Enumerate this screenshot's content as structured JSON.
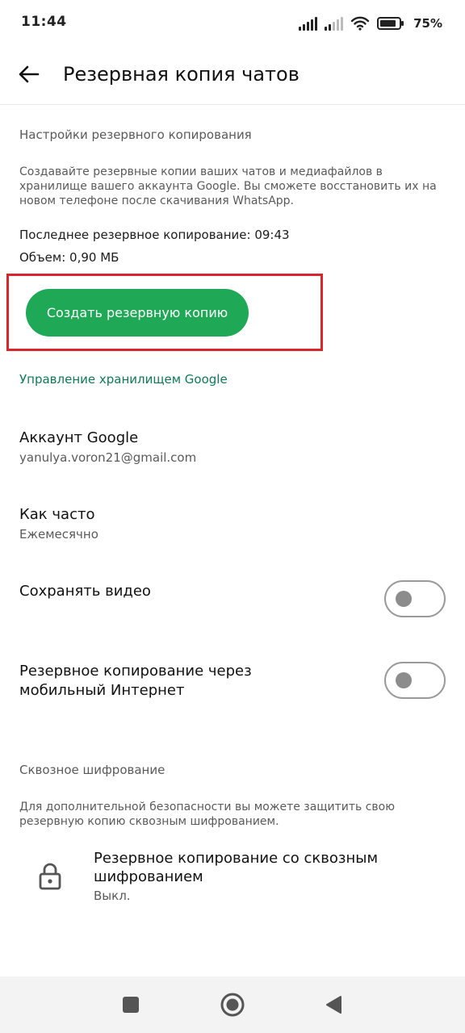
{
  "status_bar": {
    "time": "11:44",
    "battery": "75%"
  },
  "app_bar": {
    "title": "Резервная копия чатов"
  },
  "backup_settings": {
    "section_label": "Настройки резервного копирования",
    "description": "Создавайте резервные копии ваших чатов и медиафайлов в хранилище вашего аккаунта Google. Вы сможете восстановить их на новом телефоне после скачивания WhatsApp.",
    "last_backup": "Последнее резервное копирование: 09:43",
    "size": "Объем: 0,90 МБ",
    "backup_button": "Создать резервную копию",
    "manage_storage_link": "Управление хранилищем Google"
  },
  "account": {
    "title": "Аккаунт Google",
    "value": "yanulya.voron21@gmail.com"
  },
  "frequency": {
    "title": "Как часто",
    "value": "Ежемесячно"
  },
  "save_video": {
    "title": "Сохранять видео",
    "enabled": false
  },
  "mobile_data": {
    "title": "Резервное копирование через мобильный Интернет",
    "enabled": false
  },
  "encryption": {
    "section_label": "Сквозное шифрование",
    "description": "Для дополнительной безопасности вы можете защитить свою резервную копию сквозным шифрованием.",
    "item_title": "Резервное копирование со сквозным шифрованием",
    "item_value": "Выкл."
  },
  "colors": {
    "accent_green": "#1fa855",
    "link_green": "#0f7a55",
    "highlight_red": "#d7262e"
  },
  "icons": {
    "back": "arrow-left-icon",
    "lock": "lock-icon",
    "nav_recent": "square-icon",
    "nav_home": "circle-icon",
    "nav_back": "triangle-icon"
  }
}
